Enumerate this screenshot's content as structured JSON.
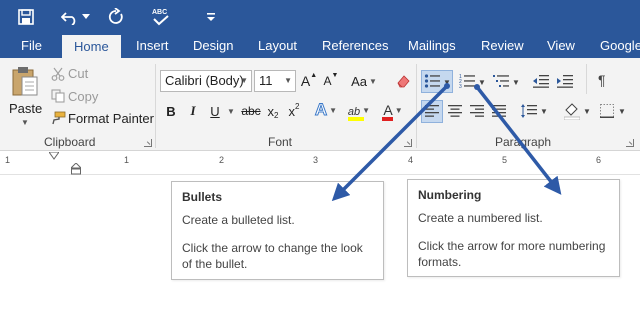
{
  "tabs": [
    "File",
    "Home",
    "Insert",
    "Design",
    "Layout",
    "References",
    "Mailings",
    "Review",
    "View",
    "Google"
  ],
  "clipboard": {
    "paste_label": "Paste",
    "cut_label": "Cut",
    "copy_label": "Copy",
    "format_painter_label": "Format Painter",
    "group_label": "Clipboard"
  },
  "font": {
    "font_name": "Calibri (Body)",
    "font_size": "11",
    "grow_label": "A",
    "shrink_label": "A",
    "case_label": "Aa",
    "bold_label": "B",
    "italic_label": "I",
    "underline_label": "U",
    "strike_label": "abc",
    "subscript_label": "x",
    "superscript_label": "x",
    "sub_mark": "2",
    "sup_mark": "2",
    "effects_label": "A",
    "highlight_label": "ab",
    "color_label": "A",
    "group_label": "Font"
  },
  "paragraph": {
    "group_label": "Paragraph",
    "sort_label": "¶"
  },
  "ruler_numbers": [
    "1",
    "1",
    "2",
    "3",
    "4",
    "5",
    "6"
  ],
  "callouts": {
    "bullets": {
      "title": "Bullets",
      "line1": "Create a bulleted list.",
      "line2": "Click the arrow to change the look",
      "line3": "of the bullet."
    },
    "numbering": {
      "title": "Numbering",
      "line1": "Create a numbered list.",
      "line2": "Click the arrow for more numbering",
      "line3": "formats."
    }
  },
  "colors": {
    "title_bar": "#2b579a",
    "ribbon_bg": "#f3f3f3",
    "arrow": "#2e5aa7",
    "highlight_yellow": "#ffff00",
    "font_color_red": "#e02020",
    "selection_blue": "#c5d8ef"
  },
  "icons": [
    "save-icon",
    "undo-icon",
    "redo-icon",
    "spelling-icon",
    "customize-qat-icon",
    "paste-icon",
    "cut-icon",
    "copy-icon",
    "format-painter-icon",
    "clear-formatting-icon",
    "bullets-icon",
    "numbering-icon",
    "multilevel-list-icon",
    "decrease-indent-icon",
    "increase-indent-icon",
    "show-marks-icon",
    "align-left-icon",
    "center-icon",
    "align-right-icon",
    "justify-icon",
    "line-spacing-icon",
    "shading-icon",
    "borders-icon"
  ]
}
